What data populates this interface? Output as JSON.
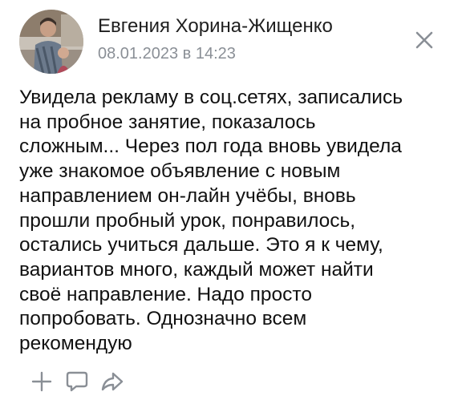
{
  "post": {
    "author": "Евгения Хорина-Жищенко",
    "date": "08.01.2023 в 14:23",
    "text": "Увидела рекламу в соц.сетях, записались\nна пробное занятие, показалось\nсложным... Через пол года вновь увидела\nуже знакомое объявление с новым\nнаправлением он-лайн учёбы, вновь\nпрошли пробный урок, понравилось,\nостались учиться дальше. Это я к чему,\nвариантов много, каждый может найти\nсвоё направление. Надо просто\nпопробовать. Однозначно всем\nрекомендую"
  },
  "icons": {
    "close": "close-icon",
    "add": "plus-icon",
    "comment": "comment-icon",
    "share": "share-icon"
  },
  "colors": {
    "text": "#111111",
    "secondary": "#8a8f96",
    "icon": "#8a8f96"
  }
}
